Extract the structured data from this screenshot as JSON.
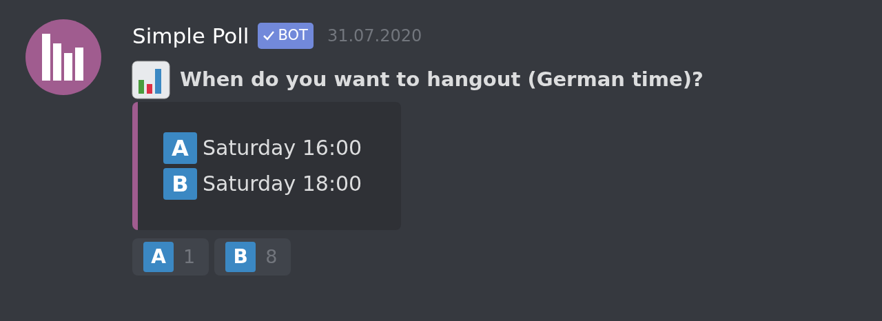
{
  "message": {
    "author": "Simple Poll",
    "badge": "BOT",
    "timestamp": "31.07.2020",
    "title": "When do you want to hangout (German time)?"
  },
  "embed": {
    "color": "#a05c8f",
    "options": [
      {
        "letter": "A",
        "text": "Saturday 16:00"
      },
      {
        "letter": "B",
        "text": "Saturday 18:00"
      }
    ]
  },
  "reactions": [
    {
      "letter": "A",
      "count": "1"
    },
    {
      "letter": "B",
      "count": "8"
    }
  ]
}
